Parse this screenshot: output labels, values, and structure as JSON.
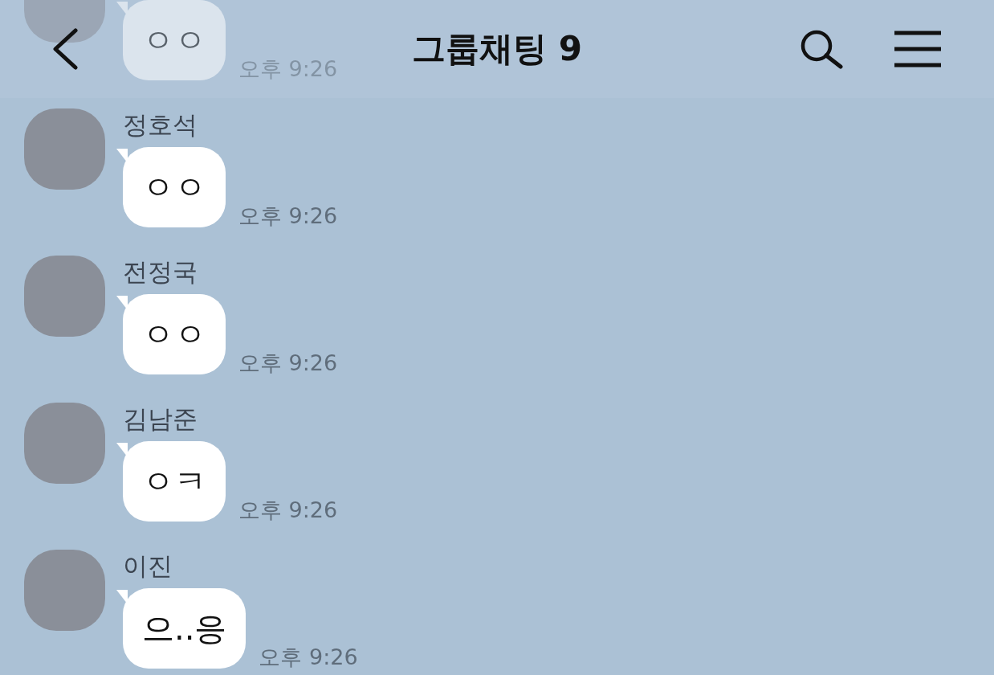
{
  "header": {
    "title": "그룹채팅 9"
  },
  "messages": [
    {
      "text": "ㅇㅇ",
      "time": "오후 9:26"
    },
    {
      "name": "정호석",
      "text": "ㅇㅇ",
      "time": "오후 9:26"
    },
    {
      "name": "전정국",
      "text": "ㅇㅇ",
      "time": "오후 9:26"
    },
    {
      "name": "김남준",
      "text": "ㅇㅋ",
      "time": "오후 9:26"
    },
    {
      "name": "이진",
      "text": "으..응",
      "time": "오후 9:26"
    }
  ]
}
